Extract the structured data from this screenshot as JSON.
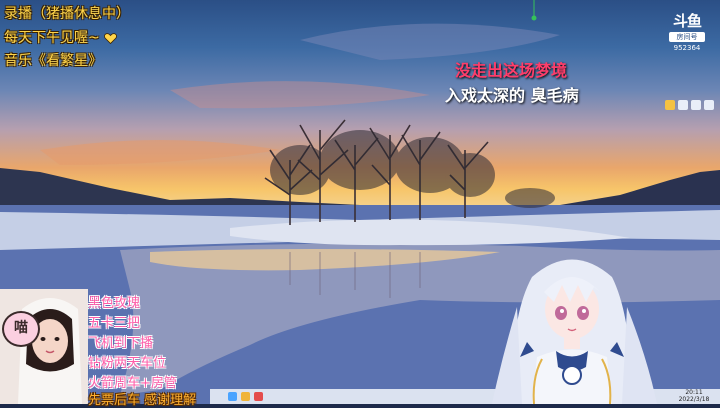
{
  "overlay": {
    "line1": "录播（猪播休息中）",
    "line2": "每天下午见喔~",
    "line3": "音乐《看繁星》"
  },
  "lyrics": {
    "line_a": "没走出这场梦境",
    "line_b": "入戏太深的 臭毛病"
  },
  "badge": {
    "logo": "斗鱼",
    "tag": "房间号",
    "room_number": "952364"
  },
  "webcam": {
    "sticker_text": "喵"
  },
  "gifts": [
    "黑色玫瑰",
    "五卡三把",
    "飞机到下播",
    "钻粉两天车位",
    "火箭周车+房管",
    "先票后车 感谢理解"
  ],
  "clock": {
    "time": "20:11",
    "date": "2022/3/18"
  },
  "colors": {
    "overlay_text": "#ffd54a",
    "lyric_highlight": "#ff3d6a",
    "gift_text": "#ff5ca8"
  },
  "icons": {
    "heart": "heart-icon",
    "cat_sticker": "cat-face-icon"
  }
}
